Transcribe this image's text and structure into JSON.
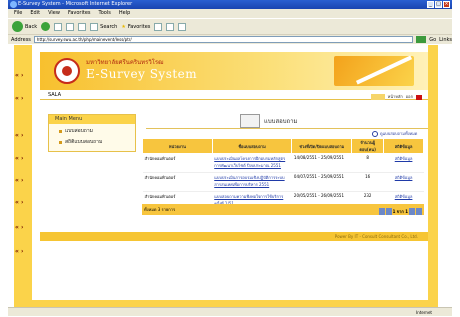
{
  "window": {
    "title": "E-Survey System - Microsoft Internet Explorer"
  },
  "menu": [
    "File",
    "Edit",
    "View",
    "Favorites",
    "Tools",
    "Help"
  ],
  "toolbar": {
    "back": "Back",
    "search": "Search",
    "favorites": "Favorites"
  },
  "address": {
    "label": "Address",
    "url": "http://survey.swu.ac.th/php/mainevent/less/ptr/",
    "go": "Go",
    "links": "Links"
  },
  "header": {
    "university": "มหาวิทยาลัยศรีนครินทรวิโรฒ",
    "system": "E-Survey System"
  },
  "bar": {
    "user": "SALA",
    "home": "หน้าหลัก",
    "logout": "ออก"
  },
  "sidemenu": {
    "title": "Main Menu",
    "items": [
      "แบบสอบถาม",
      "สถิติแบบสอบถาม"
    ]
  },
  "main": {
    "title": "แบบสอบถาม",
    "view_all": "ดูแบบสอบถามทั้งหมด"
  },
  "table": {
    "headers": [
      "หน่วยงาน",
      "ชื่อแบบสอบถาม",
      "ช่วงที่เปิด/ปิดแบบสอบถาม",
      "จำนวนผู้ตอบ(คน)",
      "สถิติข้อมูล"
    ],
    "rows": [
      {
        "unit": "สำนักคอมพิวเตอร์",
        "name": "แบบประเมินผลโครงการฝึกอบรมหลักสูตรการพัฒนาเว็บไซต์ ปีงบประมาณ 2551",
        "period": "14/08/2551 - 25/09/2551",
        "count": "8",
        "stat": "สถิติข้อมูล"
      },
      {
        "unit": "สำนักคอมพิวเตอร์",
        "name": "แบบประเมินการอบรมเชิงปฏิบัติการระบบสารสนเทศเพื่อการบริหาร 2551",
        "period": "04/07/2551 - 25/09/2551",
        "count": "16",
        "stat": "สถิติข้อมูล"
      },
      {
        "unit": "สำนักคอมพิวเตอร์",
        "name": "แบบสอบถามความพึงพอใจการใช้บริการ ครั้งที่ 1/51",
        "period": "20/05/2551 - 26/09/2551",
        "count": "232",
        "stat": "สถิติข้อมูล"
      }
    ],
    "footer": "ทั้งหมด 3 รายการ",
    "pager": "1 จาก 1"
  },
  "footer": "Power By IT - Consult Consultant Co., Ltd.",
  "status": {
    "zone": "Internet"
  }
}
